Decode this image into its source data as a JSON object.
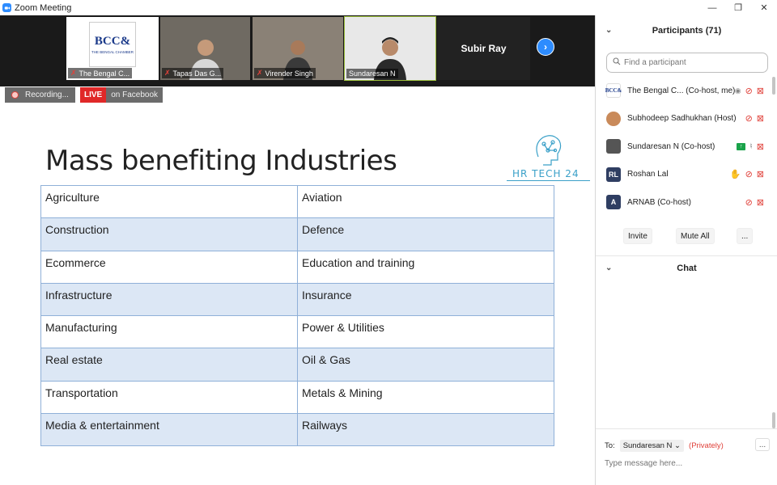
{
  "window": {
    "title": "Zoom Meeting",
    "minimize": "—",
    "restore": "❐",
    "close": "✕"
  },
  "videos": [
    {
      "name": "The Bengal C...",
      "logo_big": "BCC&",
      "logo_small": "THE BENGAL CHAMBER"
    },
    {
      "name": "Tapas Das G..."
    },
    {
      "name": "Virender Singh"
    },
    {
      "name": "Sundaresan N"
    }
  ],
  "featured_name": "Subir Ray",
  "next_arrow": "›",
  "badges": {
    "recording": "Recording...",
    "live": "LIVE",
    "live_target": "on Facebook"
  },
  "slide": {
    "title": "Mass benefiting Industries",
    "logo_text": "HR TECH 24",
    "rows": [
      [
        "Agriculture",
        "Aviation"
      ],
      [
        "Construction",
        "Defence"
      ],
      [
        "Ecommerce",
        "Education and training"
      ],
      [
        "Infrastructure",
        "Insurance"
      ],
      [
        "Manufacturing",
        "Power & Utilities"
      ],
      [
        "Real estate",
        "Oil & Gas"
      ],
      [
        "Transportation",
        "Metals & Mining"
      ],
      [
        "Media & entertainment",
        "Railways"
      ]
    ]
  },
  "participants": {
    "header": "Participants (71)",
    "search_placeholder": "Find a participant",
    "list": [
      {
        "name": "The Bengal C... (Co-host, me)",
        "avatar": "BCC&",
        "avatar_color": "#ffffff"
      },
      {
        "name": "Subhodeep Sadhukhan (Host)",
        "avatar": "",
        "avatar_color": "#c98a5a"
      },
      {
        "name": "Sundaresan N (Co-host)",
        "avatar": "",
        "avatar_color": "#555555"
      },
      {
        "name": "Roshan Lal",
        "avatar": "RL",
        "avatar_color": "#2f3e62"
      },
      {
        "name": "ARNAB (Co-host)",
        "avatar": "A",
        "avatar_color": "#2f3e62"
      }
    ],
    "invite": "Invite",
    "mute_all": "Mute All",
    "more": "..."
  },
  "chat": {
    "header": "Chat",
    "to_label": "To:",
    "to_value": "Sundaresan N",
    "privately": "(Privately)",
    "input_placeholder": "Type message here...",
    "more": "..."
  },
  "colors": {
    "accent": "#2d8cff",
    "muted_red": "#e0413a",
    "table_stripe": "#dce7f5",
    "table_border": "#8fb0d8",
    "logo": "#3aa0c8"
  }
}
